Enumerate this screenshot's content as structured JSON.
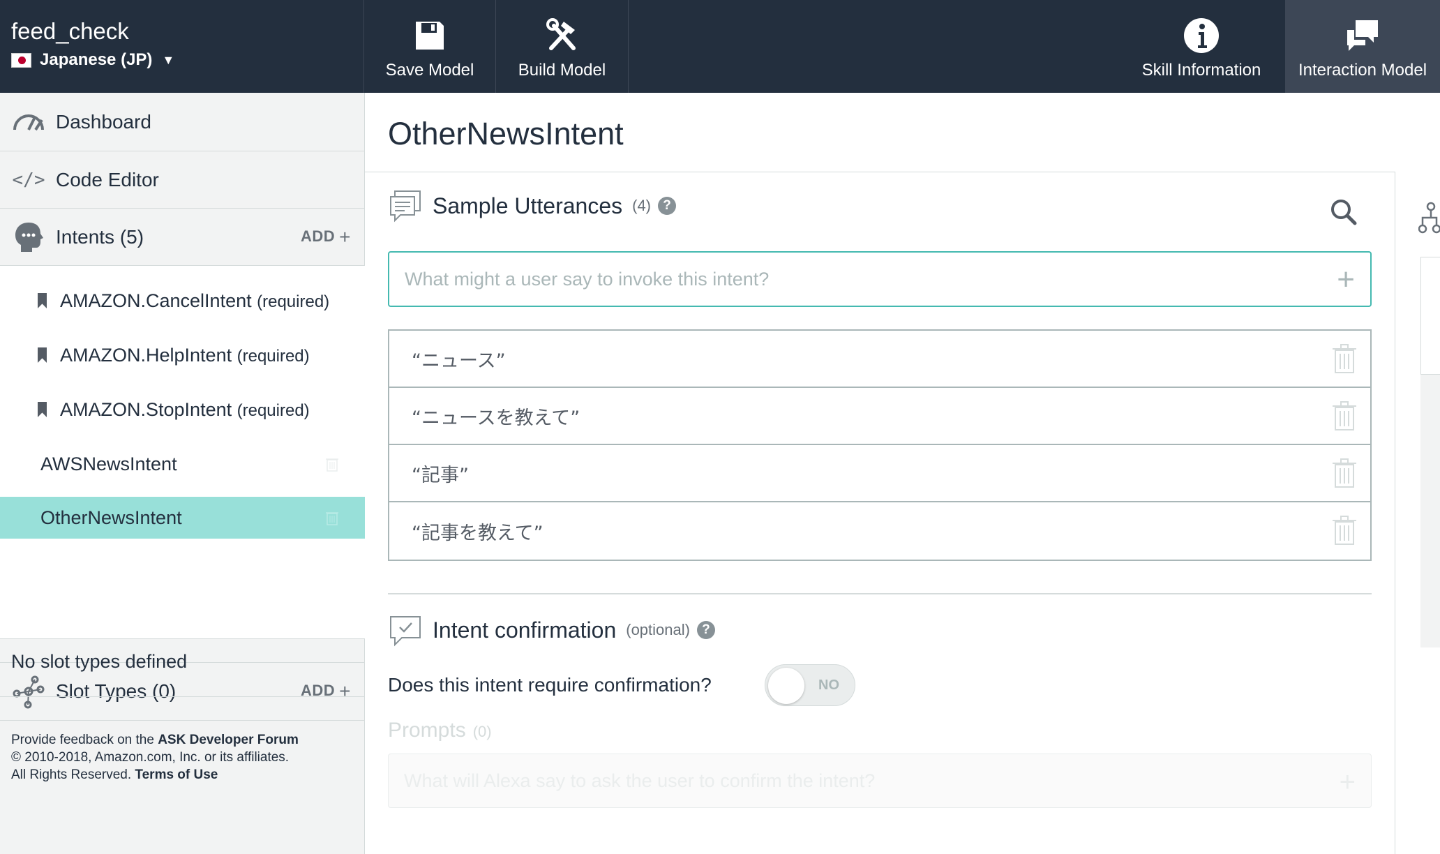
{
  "header": {
    "skill_name": "feed_check",
    "locale": "Japanese (JP)",
    "buttons": {
      "save": "Save Model",
      "build": "Build Model",
      "info": "Skill Information",
      "model": "Interaction Model"
    }
  },
  "sidebar": {
    "dashboard": "Dashboard",
    "code_editor": "Code Editor",
    "intents_label": "Intents (5)",
    "add_label": "ADD",
    "intents": [
      {
        "name": "AMAZON.CancelIntent",
        "tag": "(required)"
      },
      {
        "name": "AMAZON.HelpIntent",
        "tag": "(required)"
      },
      {
        "name": "AMAZON.StopIntent",
        "tag": "(required)"
      },
      {
        "name": "AWSNewsIntent"
      },
      {
        "name": "OtherNewsIntent",
        "selected": true
      }
    ],
    "slot_types_label": "Slot Types (0)",
    "no_slots": "No slot types defined",
    "footer": {
      "feedback_prefix": "Provide feedback on the ",
      "forum_link": "ASK Developer Forum",
      "copyright": "© 2010-2018, Amazon.com, Inc. or its affiliates.",
      "rights": "All Rights Reserved. ",
      "terms_link": "Terms of Use"
    }
  },
  "main": {
    "intent_title": "OtherNewsIntent",
    "utterances": {
      "title": "Sample Utterances",
      "count": "(4)",
      "help": "?",
      "input_placeholder": "What might a user say to invoke this intent?",
      "add_symbol": "+",
      "items": [
        "“ニュース”",
        "“ニュースを教えて”",
        "“記事”",
        "“記事を教えて”"
      ]
    },
    "confirmation": {
      "title": "Intent confirmation",
      "optional": "(optional)",
      "help": "?",
      "question": "Does this intent require confirmation?",
      "toggle_label": "NO",
      "prompts_label": "Prompts",
      "prompts_count": "(0)",
      "prompt_placeholder": "What will Alexa say to ask the user to confirm the intent?",
      "add_symbol": "+"
    }
  }
}
